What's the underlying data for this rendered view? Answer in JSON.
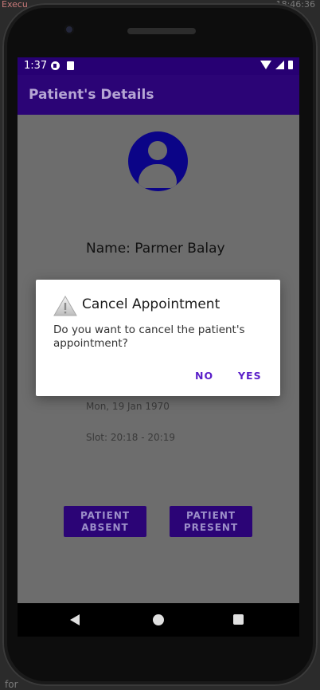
{
  "ide": {
    "top_left_text": "Execu",
    "top_right_text": "18:46:36",
    "bottom_left_text": "for"
  },
  "status_bar": {
    "time": "1:37"
  },
  "app_bar": {
    "title": "Patient's Details"
  },
  "patient": {
    "name": "Name: Parmer Balay",
    "date": "Mon, 19 Jan 1970",
    "slot": "Slot: 20:18 - 20:19"
  },
  "actions": {
    "absent_label": "PATIENT ABSENT",
    "present_label": "PATIENT PRESENT"
  },
  "dialog": {
    "title": "Cancel Appointment",
    "message": "Do you want to cancel the patient's appointment?",
    "no_label": "NO",
    "yes_label": "YES"
  },
  "colors": {
    "status_bar": "#270073",
    "app_bar": "#2b0476",
    "avatar": "#0b0487",
    "dialog_button": "#5a1fc9",
    "scrim_background": "#6d6d6d"
  },
  "icons": {
    "avatar": "account-circle-icon",
    "dialog": "warning-icon",
    "nav": [
      "back-icon",
      "home-icon",
      "recents-icon"
    ]
  }
}
